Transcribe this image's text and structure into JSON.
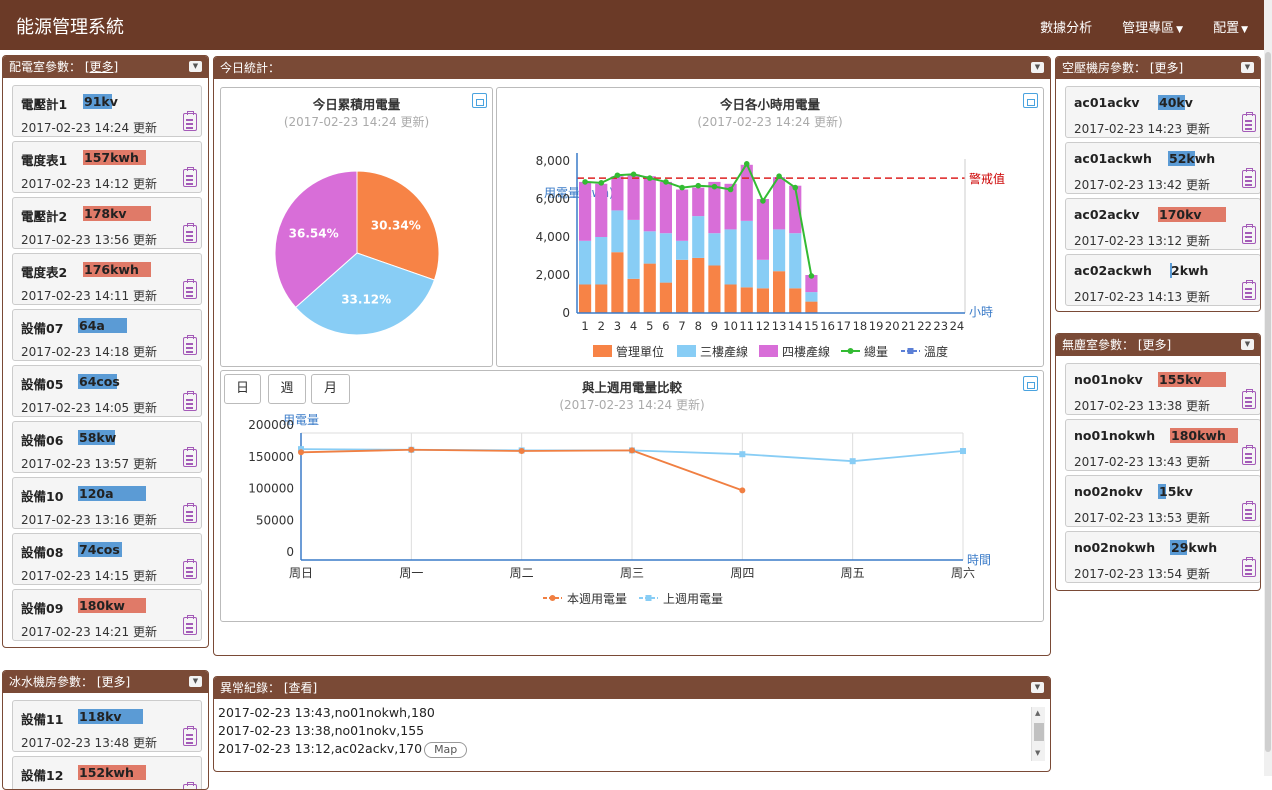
{
  "app": {
    "title": "能源管理系統",
    "nav": [
      "數據分析",
      "管理專區",
      "配置"
    ]
  },
  "panels": {
    "power_room": {
      "title": "配電室參數：",
      "more": "[更多]"
    },
    "today": {
      "title": "今日統計："
    },
    "air": {
      "title": "空壓機房參數：",
      "more": "[更多]"
    },
    "dust": {
      "title": "無塵室參數：",
      "more": "[更多]"
    },
    "water": {
      "title": "冰水機房參數：",
      "more": "[更多]"
    },
    "alarm": {
      "title": "異常紀錄：",
      "more": "[查看]"
    }
  },
  "power_cards": [
    {
      "name": "電壓計1",
      "value": "91kv",
      "time": "2017-02-23 14:24 更新",
      "fill": 0.42,
      "color": "#5b9bd5"
    },
    {
      "name": "電度表1",
      "value": "157kwh",
      "time": "2017-02-23 14:12 更新",
      "fill": 0.92,
      "color": "#e07a68"
    },
    {
      "name": "電壓計2",
      "value": "178kv",
      "time": "2017-02-23 13:56 更新",
      "fill": 1.0,
      "color": "#e07a68"
    },
    {
      "name": "電度表2",
      "value": "176kwh",
      "time": "2017-02-23 14:11 更新",
      "fill": 1.0,
      "color": "#e07a68"
    },
    {
      "name": "設備07",
      "value": "64a",
      "time": "2017-02-23 14:18 更新",
      "fill": 0.72,
      "color": "#5b9bd5"
    },
    {
      "name": "設備05",
      "value": "64cos",
      "time": "2017-02-23 14:05 更新",
      "fill": 0.58,
      "color": "#5b9bd5"
    },
    {
      "name": "設備06",
      "value": "58kw",
      "time": "2017-02-23 13:57 更新",
      "fill": 0.55,
      "color": "#5b9bd5"
    },
    {
      "name": "設備10",
      "value": "120a",
      "time": "2017-02-23 13:16 更新",
      "fill": 1.0,
      "color": "#5b9bd5"
    },
    {
      "name": "設備08",
      "value": "74cos",
      "time": "2017-02-23 14:15 更新",
      "fill": 0.65,
      "color": "#5b9bd5"
    },
    {
      "name": "設備09",
      "value": "180kw",
      "time": "2017-02-23 14:21 更新",
      "fill": 1.0,
      "color": "#e07a68"
    }
  ],
  "water_cards": [
    {
      "name": "設備11",
      "value": "118kv",
      "time": "2017-02-23 13:48 更新",
      "fill": 0.95,
      "color": "#5b9bd5"
    },
    {
      "name": "設備12",
      "value": "152kwh",
      "time": "",
      "fill": 1.0,
      "color": "#e07a68"
    }
  ],
  "air_cards": [
    {
      "name": "ac01ackv",
      "value": "40kv",
      "time": "2017-02-23 14:23 更新",
      "fill": 0.4,
      "color": "#5b9bd5"
    },
    {
      "name": "ac01ackwh",
      "value": "52kwh",
      "time": "2017-02-23 13:42 更新",
      "fill": 0.4,
      "color": "#5b9bd5"
    },
    {
      "name": "ac02ackv",
      "value": "170kv",
      "time": "2017-02-23 13:12 更新",
      "fill": 1.0,
      "color": "#e07a68"
    },
    {
      "name": "ac02ackwh",
      "value": "2kwh",
      "time": "2017-02-23 14:13 更新",
      "fill": 0.0,
      "color": "#5b9bd5"
    }
  ],
  "dust_cards": [
    {
      "name": "no01nokv",
      "value": "155kv",
      "time": "2017-02-23 13:38 更新",
      "fill": 1.0,
      "color": "#e07a68"
    },
    {
      "name": "no01nokwh",
      "value": "180kwh",
      "time": "2017-02-23 13:43 更新",
      "fill": 1.0,
      "color": "#e07a68"
    },
    {
      "name": "no02nokv",
      "value": "15kv",
      "time": "2017-02-23 13:53 更新",
      "fill": 0.12,
      "color": "#5b9bd5"
    },
    {
      "name": "no02nokwh",
      "value": "29kwh",
      "time": "2017-02-23 13:54 更新",
      "fill": 0.25,
      "color": "#5b9bd5"
    }
  ],
  "pie": {
    "title": "今日累積用電量",
    "subtitle": "(2017-02-23 14:24 更新)"
  },
  "hourly": {
    "title": "今日各小時用電量",
    "subtitle": "(2017-02-23 14:24 更新)",
    "warn_label": "警戒值"
  },
  "weekly": {
    "title": "與上週用電量比較",
    "subtitle": "(2017-02-23 14:24 更新)",
    "buttons": [
      "日",
      "週",
      "月"
    ]
  },
  "alarm_log": [
    "2017-02-23 13:43,no01nokwh,180",
    "2017-02-23 13:38,no01nokv,155",
    "2017-02-23 13:12,ac02ackv,170"
  ],
  "alarm_map_label": "Map",
  "chart_data": [
    {
      "type": "pie",
      "title": "今日累積用電量",
      "labels": [
        "管理單位",
        "三樓產線",
        "四樓產線"
      ],
      "values": [
        30.34,
        33.12,
        36.54
      ],
      "colors": [
        "#f78346",
        "#88cdf5",
        "#d86ed8"
      ]
    },
    {
      "type": "bar",
      "stacked": true,
      "title": "今日各小時用電量",
      "ylabel": "用電量(kwh)",
      "xlabel": "小時",
      "ylim": [
        0,
        8000
      ],
      "yticks": [
        0,
        2000,
        4000,
        6000,
        8000
      ],
      "ytick_labels": [
        "0",
        "2,000",
        "4,000",
        "6,000",
        "8,000"
      ],
      "categories": [
        "1",
        "2",
        "3",
        "4",
        "5",
        "6",
        "7",
        "8",
        "9",
        "10",
        "11",
        "12",
        "13",
        "14",
        "15",
        "16",
        "17",
        "18",
        "19",
        "20",
        "21",
        "22",
        "23",
        "24"
      ],
      "series": [
        {
          "name": "管理單位",
          "color": "#f78346",
          "values": [
            1500,
            1500,
            3200,
            1800,
            2600,
            1600,
            2800,
            2900,
            2500,
            1500,
            1350,
            1300,
            2200,
            1300,
            600
          ]
        },
        {
          "name": "三樓產線",
          "color": "#88cdf5",
          "values": [
            2300,
            2500,
            2200,
            3100,
            1700,
            2600,
            1000,
            2200,
            1700,
            2900,
            3500,
            1500,
            2200,
            2900,
            500
          ]
        },
        {
          "name": "四樓產線",
          "color": "#d86ed8",
          "values": [
            3100,
            2800,
            1800,
            2400,
            2900,
            2700,
            2700,
            1500,
            2700,
            2400,
            2950,
            3200,
            2750,
            2500,
            900
          ]
        },
        {
          "name": "總量",
          "color": "#33bb33",
          "values": [
            6900,
            6850,
            7250,
            7300,
            7100,
            6900,
            6600,
            6700,
            6650,
            6500,
            7850,
            5900,
            7200,
            6600,
            1950
          ]
        },
        {
          "name": "溫度",
          "color": "#5b7fd6",
          "values": []
        }
      ],
      "warning_value": 7100,
      "warning_label": "警戒值",
      "legend": "bottom"
    },
    {
      "type": "line",
      "title": "與上週用電量比較",
      "ylabel": "用電量",
      "xlabel": "時間",
      "ylim": [
        0,
        200000
      ],
      "yticks": [
        0,
        50000,
        100000,
        150000,
        200000
      ],
      "categories": [
        "周日",
        "周一",
        "周二",
        "周三",
        "周四",
        "周五",
        "周六"
      ],
      "series": [
        {
          "name": "本週用電量",
          "color": "#f07f42",
          "values": [
            157000,
            161000,
            159000,
            160000,
            97000
          ]
        },
        {
          "name": "上週用電量",
          "color": "#88cdf5",
          "values": [
            162000,
            161000,
            160000,
            160000,
            154000,
            143000,
            159000
          ]
        }
      ],
      "legend": "bottom"
    }
  ]
}
